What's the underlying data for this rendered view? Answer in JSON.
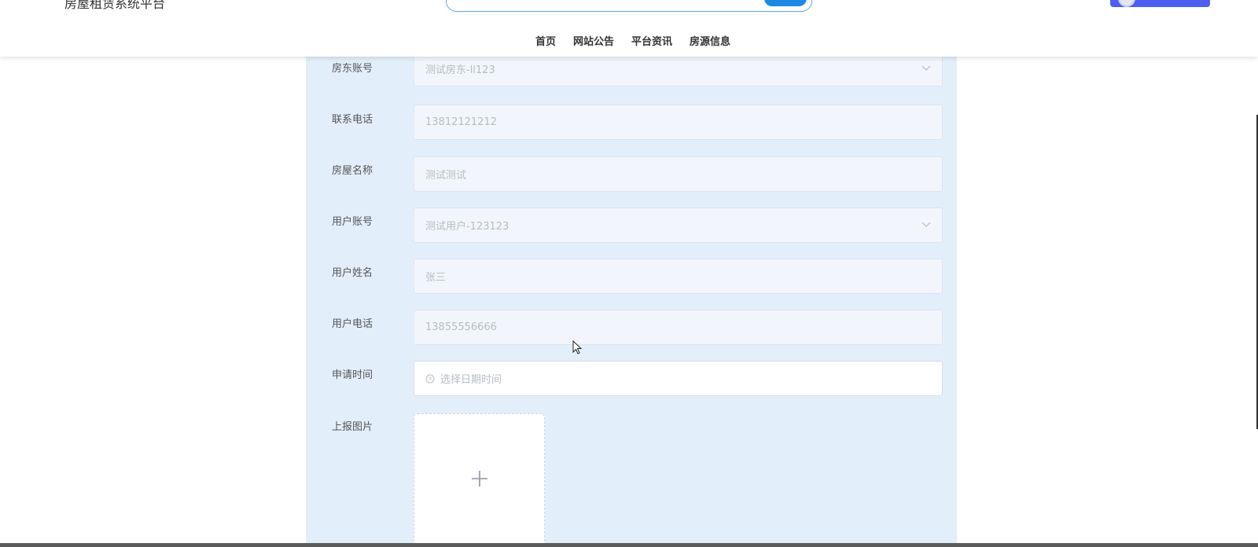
{
  "header": {
    "site_title": "房屋租赁系统平台",
    "nav": [
      "首页",
      "网站公告",
      "平台资讯",
      "房源信息"
    ]
  },
  "form": {
    "fields": [
      {
        "label": "房东账号",
        "value": "测试房东-ll123",
        "type": "select"
      },
      {
        "label": "联系电话",
        "value": "13812121212",
        "type": "input"
      },
      {
        "label": "房屋名称",
        "value": "测试测试",
        "type": "input"
      },
      {
        "label": "用户账号",
        "value": "测试用户-123123",
        "type": "select"
      },
      {
        "label": "用户姓名",
        "value": "张三",
        "type": "input"
      },
      {
        "label": "用户电话",
        "value": "13855556666",
        "type": "input"
      },
      {
        "label": "申请时间",
        "placeholder": "选择日期时间",
        "type": "datetime"
      }
    ],
    "upload_label": "上报图片"
  },
  "colors": {
    "panel_bg": "#e3eefb",
    "accent": "#1e88e5",
    "user_button": "#4e5ef0"
  },
  "icons": {
    "select": "chevron-down-icon",
    "datetime": "clock-icon",
    "upload": "plus-icon"
  }
}
